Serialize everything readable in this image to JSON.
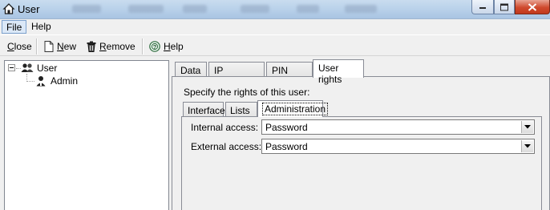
{
  "window": {
    "title": "User"
  },
  "menu": {
    "items": [
      "File",
      "Help"
    ]
  },
  "toolbar": {
    "close": {
      "hot": "C",
      "rest": "lose"
    },
    "new": {
      "hot": "N",
      "rest": "ew"
    },
    "remove": {
      "hot": "R",
      "rest": "emove"
    },
    "help": {
      "hot": "H",
      "rest": "elp"
    }
  },
  "tree": {
    "root": "User",
    "children": [
      "Admin"
    ]
  },
  "tabs": [
    "Data",
    "IP restriction",
    "PIN query",
    "User rights"
  ],
  "active_tab": "User rights",
  "rights": {
    "prompt": "Specify the rights of this user:",
    "subtabs": [
      "Interface",
      "Lists",
      "Administration"
    ],
    "active_subtab": "Administration",
    "fields": [
      {
        "label": "Internal access:",
        "value": "Password"
      },
      {
        "label": "External access:",
        "value": "Password"
      }
    ]
  }
}
